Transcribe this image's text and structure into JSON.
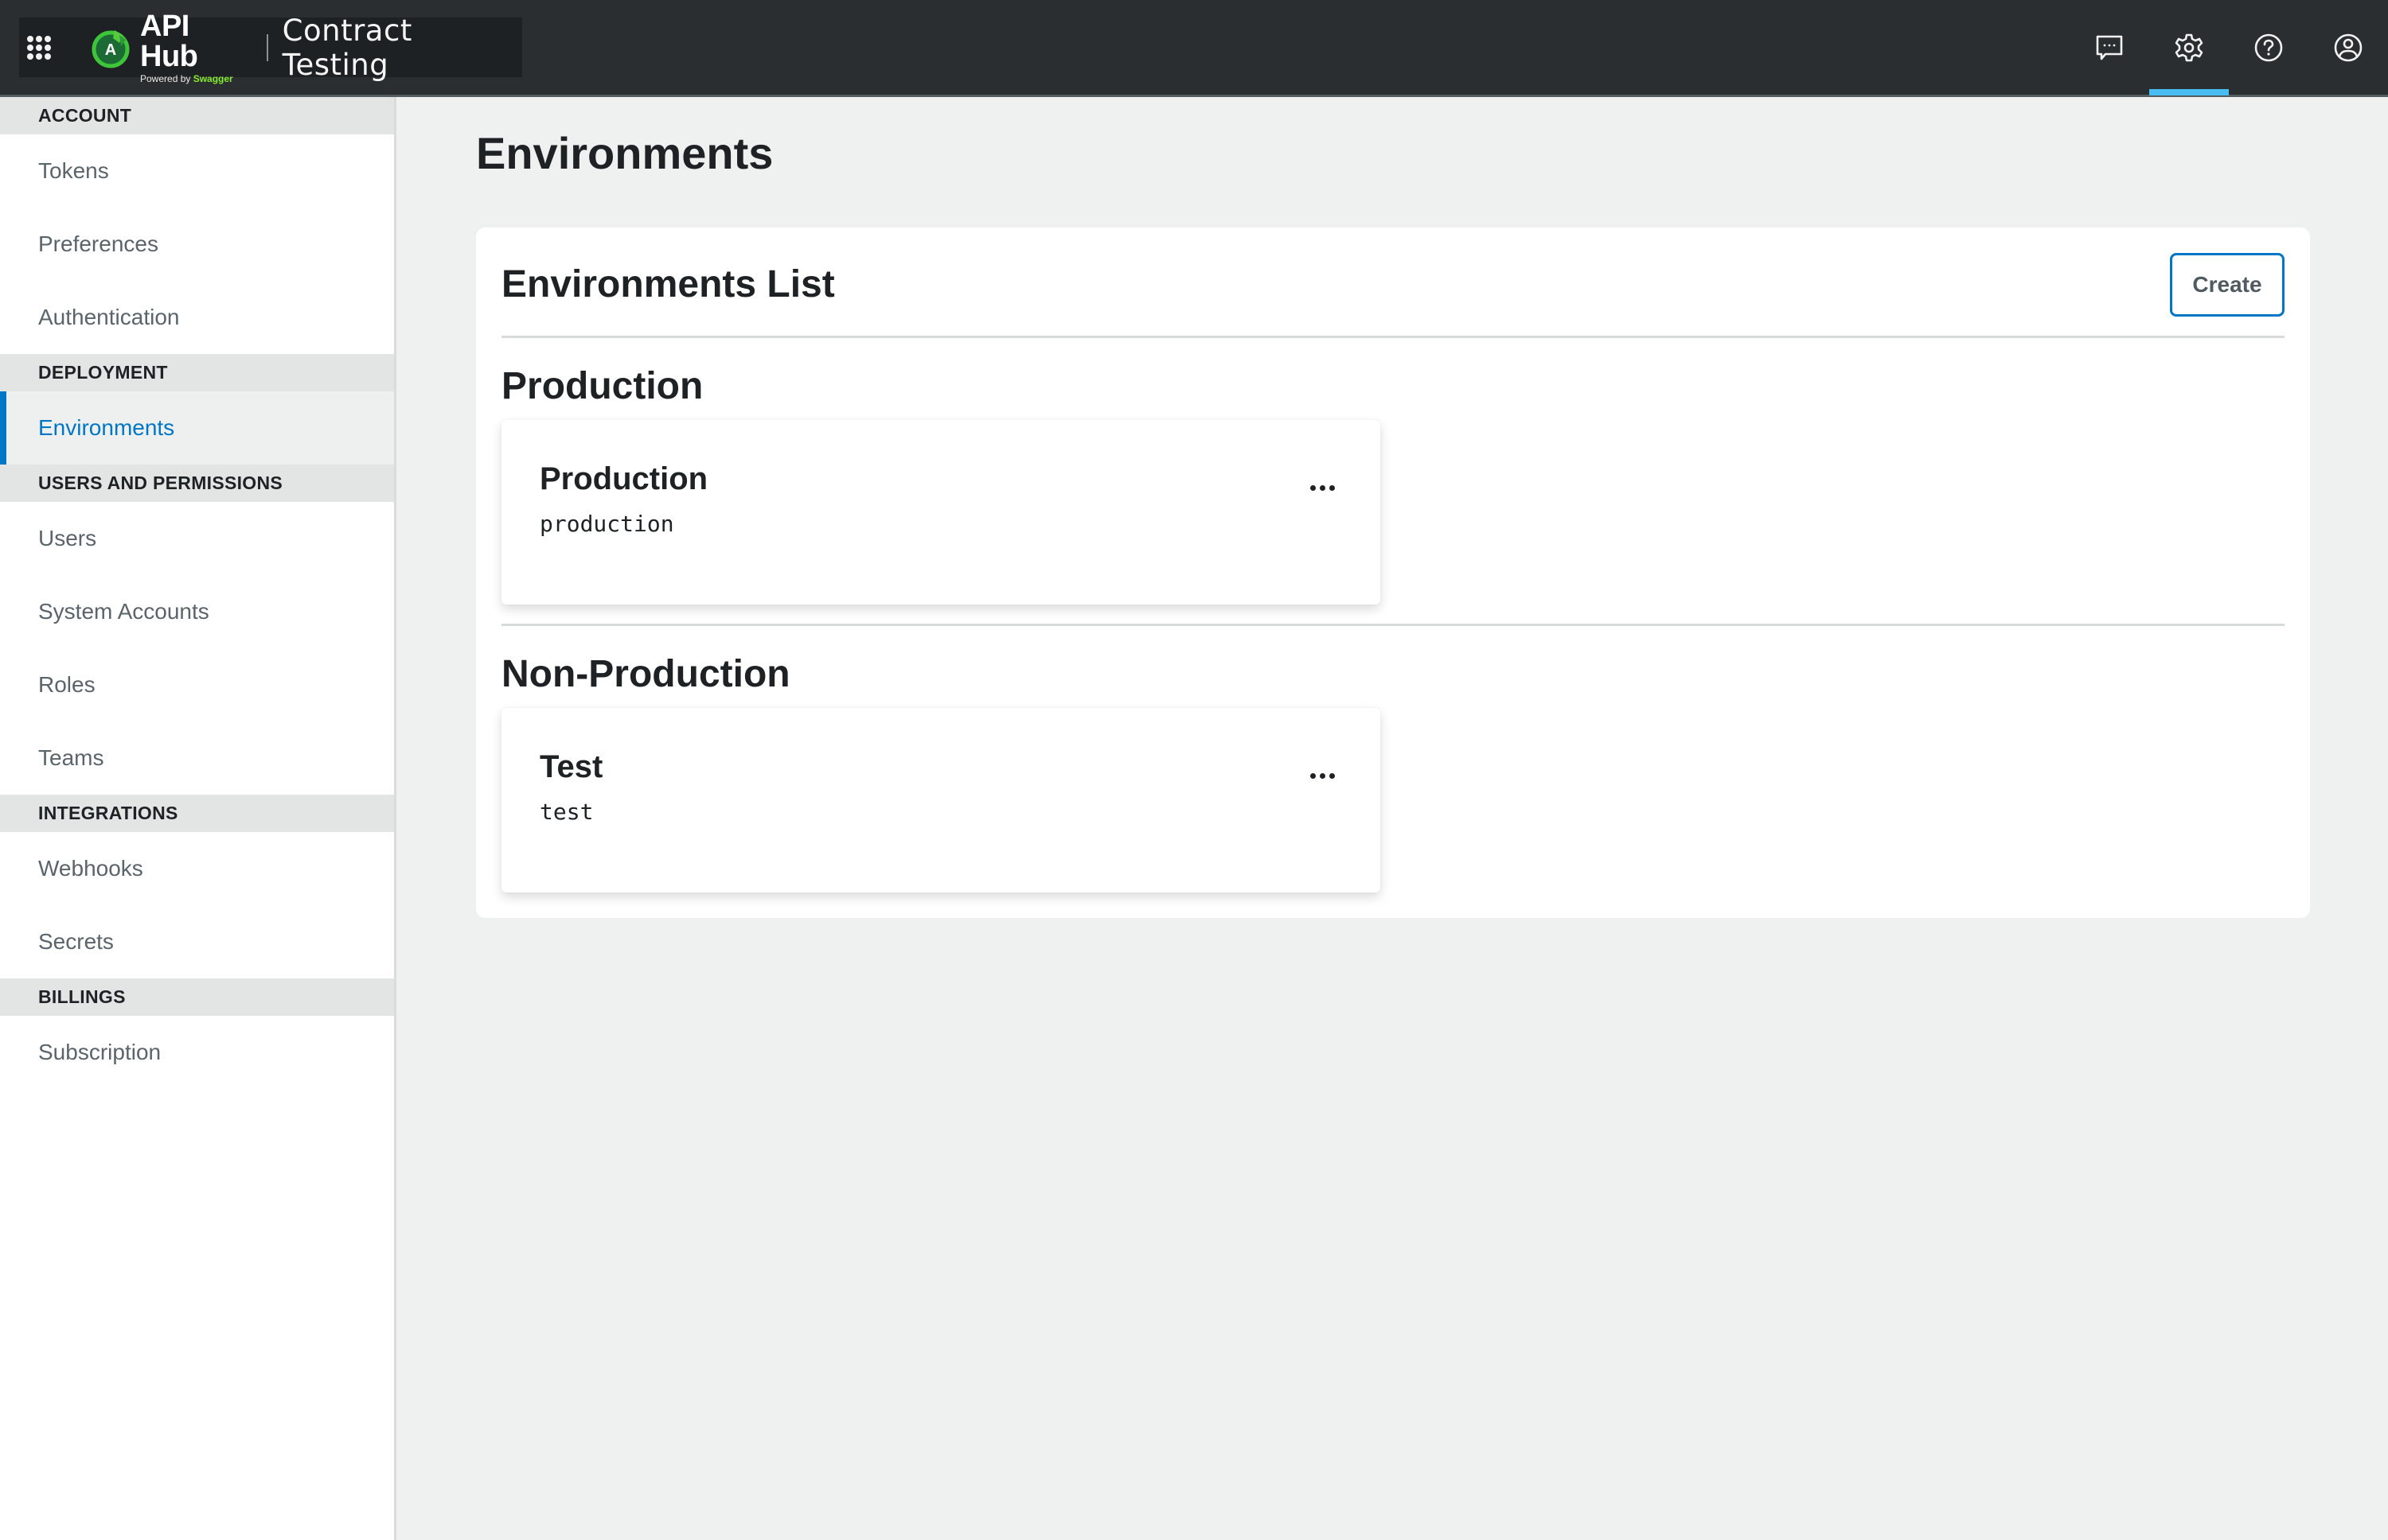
{
  "header": {
    "brand_name": "API Hub",
    "brand_powered_prefix": "Powered by ",
    "brand_powered_name": "Swagger",
    "product_name": "Contract Testing",
    "icons": [
      {
        "name": "feedback-chat-icon",
        "active": false
      },
      {
        "name": "settings-gear-icon",
        "active": true
      },
      {
        "name": "help-icon",
        "active": false
      },
      {
        "name": "user-profile-icon",
        "active": false
      }
    ],
    "accent_color": "#49bdf2"
  },
  "sidebar": {
    "sections": [
      {
        "title": "ACCOUNT",
        "items": [
          {
            "label": "Tokens",
            "active": false
          },
          {
            "label": "Preferences",
            "active": false
          },
          {
            "label": "Authentication",
            "active": false
          }
        ]
      },
      {
        "title": "DEPLOYMENT",
        "items": [
          {
            "label": "Environments",
            "active": true
          }
        ]
      },
      {
        "title": "USERS AND PERMISSIONS",
        "items": [
          {
            "label": "Users",
            "active": false
          },
          {
            "label": "System Accounts",
            "active": false
          },
          {
            "label": "Roles",
            "active": false
          },
          {
            "label": "Teams",
            "active": false
          }
        ]
      },
      {
        "title": "INTEGRATIONS",
        "items": [
          {
            "label": "Webhooks",
            "active": false
          },
          {
            "label": "Secrets",
            "active": false
          }
        ]
      },
      {
        "title": "BILLINGS",
        "items": [
          {
            "label": "Subscription",
            "active": false
          }
        ]
      }
    ],
    "active_color": "#0076c6"
  },
  "main": {
    "page_title": "Environments",
    "panel_title": "Environments List",
    "create_label": "Create",
    "groups": [
      {
        "title": "Production",
        "environments": [
          {
            "name": "Production",
            "key": "production"
          }
        ]
      },
      {
        "title": "Non-Production",
        "environments": [
          {
            "name": "Test",
            "key": "test"
          }
        ]
      }
    ]
  }
}
